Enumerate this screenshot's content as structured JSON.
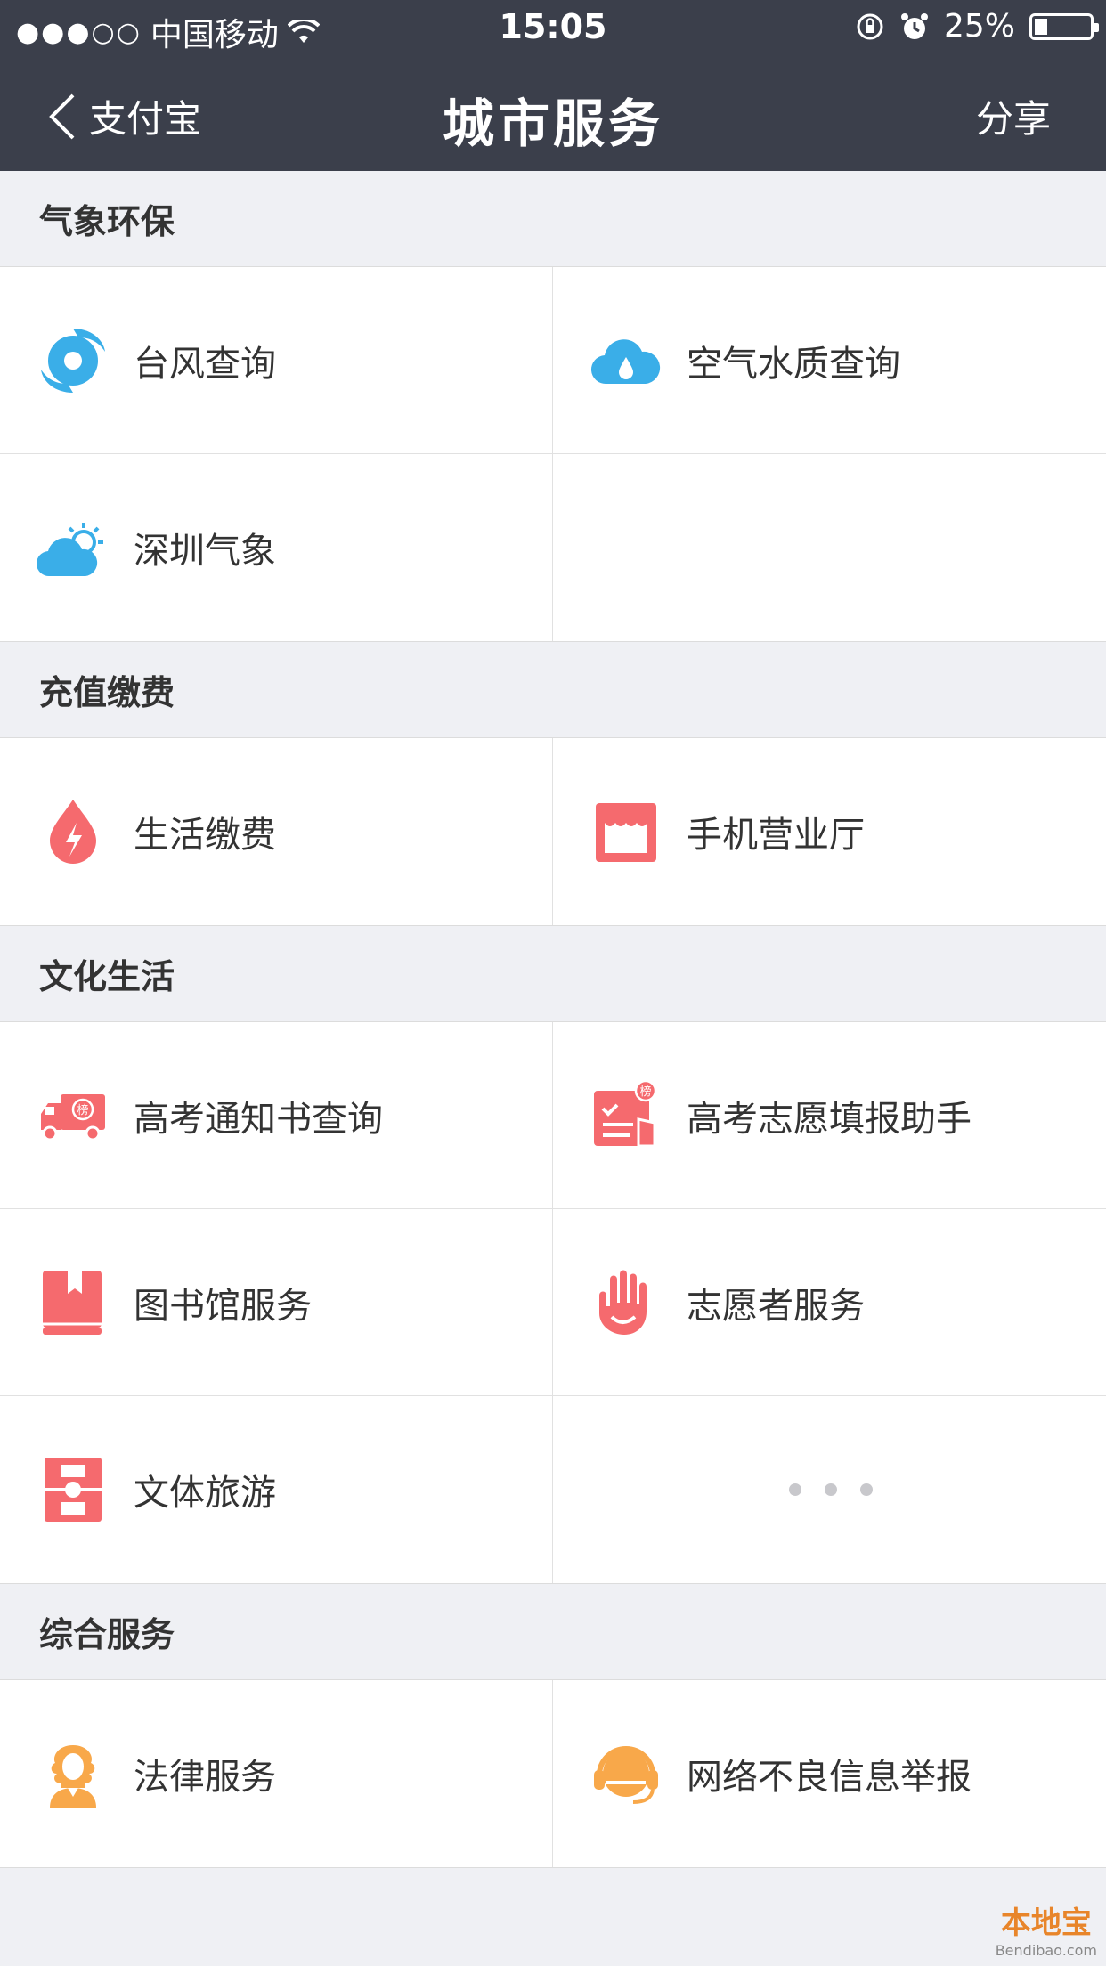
{
  "status": {
    "signal": "●●●○○",
    "carrier": "中国移动",
    "time": "15:05",
    "battery": "25%"
  },
  "nav": {
    "back": "支付宝",
    "title": "城市服务",
    "share": "分享"
  },
  "sections": [
    {
      "title": "气象环保",
      "items": [
        "台风查询",
        "空气水质查询",
        "深圳气象"
      ]
    },
    {
      "title": "充值缴费",
      "items": [
        "生活缴费",
        "手机营业厅"
      ]
    },
    {
      "title": "文化生活",
      "items": [
        "高考通知书查询",
        "高考志愿填报助手",
        "图书馆服务",
        "志愿者服务",
        "文体旅游"
      ]
    },
    {
      "title": "综合服务",
      "items": [
        "法律服务",
        "网络不良信息举报"
      ]
    }
  ],
  "icons": {
    "badge_text": "榜"
  },
  "colors": {
    "bar": "#3b3f4b",
    "blue": "#3aaee8",
    "red": "#f56a6e",
    "orange": "#f8a84a"
  },
  "watermark": {
    "name": "本地宝",
    "url": "Bendibao.com"
  }
}
